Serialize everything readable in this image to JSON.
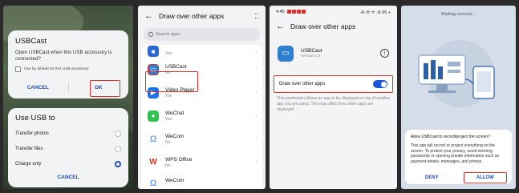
{
  "panel1": {
    "usb_dialog": {
      "title": "USBCast",
      "message": "Open USBCast when this USB accessory is connected?",
      "checkbox_label": "Use by default for this USB accessory",
      "cancel": "CANCEL",
      "ok": "OK"
    },
    "usb_mode": {
      "title": "Use USB to",
      "options": [
        "Transfer photos",
        "Transfer files",
        "Charge only"
      ],
      "selected": "Charge only",
      "cancel": "CANCEL"
    }
  },
  "panel2": {
    "title": "Draw over other apps",
    "more_icon": "⁚⁚",
    "search_placeholder": "Search apps",
    "apps": [
      {
        "name": "",
        "status": "Yes",
        "icon": "generic",
        "color": "#2a66d6"
      },
      {
        "name": "USBCast",
        "status": "No",
        "icon": "screen",
        "color": "#2f7fd0"
      },
      {
        "name": "Video Player",
        "status": "Yes",
        "icon": "play",
        "color": "#1a73e8"
      },
      {
        "name": "WeChat",
        "status": "Yes",
        "icon": "chat",
        "color": "#2dc14e"
      },
      {
        "name": "WeCom",
        "status": "No",
        "icon": "wecom",
        "color": "#2d8cf0"
      },
      {
        "name": "WPS Office",
        "status": "No",
        "icon": "wps",
        "color": "#d9331f"
      },
      {
        "name": "WeCom",
        "status": "",
        "icon": "wecom",
        "color": "#2d8cf0"
      }
    ]
  },
  "panel3": {
    "status_time": "4:45",
    "status_right": "⁂ ✉ ᯤ .ıll 95 +",
    "title": "Draw over other apps",
    "app_name": "USBCast",
    "app_version": "Version 1.9",
    "toggle_label": "Draw over other apps",
    "toggle_on": true,
    "description": "This permission allows an app to be displayed on top of another app you are using. This may affect how other apps are displayed."
  },
  "panel4": {
    "waiting_text": "Waiting connect...",
    "dialog_title": "Allow USBCast to record/project the screen?",
    "dialog_message": "This app will record or project everything on the screen. To protect your privacy, avoid entering passwords or opening private information such as payment details, messages, and photos.",
    "deny": "DENY",
    "allow": "ALLOW"
  },
  "colors": {
    "accent": "#1a4fc4",
    "highlight": "#e0302a",
    "toggle": "#1a58d8"
  }
}
